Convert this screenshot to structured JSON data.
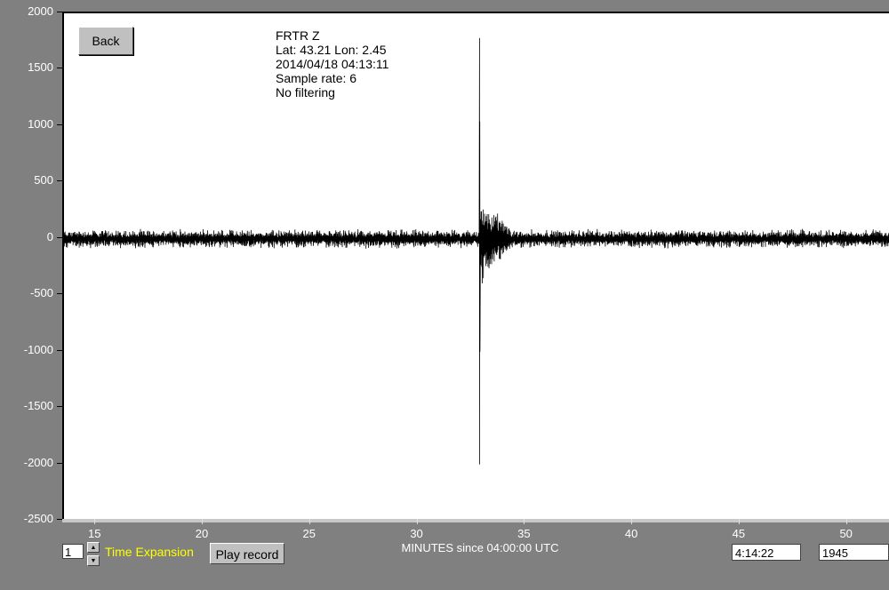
{
  "plot": {
    "info": {
      "station": "FRTR  Z",
      "location": "Lat: 43.21 Lon: 2.45",
      "datetime": "2014/04/18 04:13:11",
      "sample_rate": "Sample rate: 6",
      "filter": "No filtering"
    }
  },
  "controls": {
    "back_label": "Back",
    "time_expansion_value": "1",
    "time_expansion_label": "Time Expansion",
    "play_label": "Play record",
    "cursor_time": "4:14:22",
    "sample_index": "1945"
  },
  "colors": {
    "background": "#808080",
    "plot_bg": "#ffffff",
    "trace": "#000000",
    "axis_text": "#ffffff",
    "time_expansion_label": "#ffff00"
  },
  "chart_data": {
    "type": "line",
    "xlabel": "MINUTES since 04:00:00 UTC",
    "ylabel": "",
    "xlim": [
      13.5,
      52
    ],
    "ylim": [
      -2500,
      2000
    ],
    "xticks": [
      "15",
      "20",
      "25",
      "30",
      "35",
      "40",
      "45",
      "50"
    ],
    "yticks": [
      "2000",
      "1500",
      "1000",
      "500",
      "0",
      "-500",
      "-1000",
      "-1500",
      "-2000",
      "-2500"
    ],
    "series": [
      {
        "values_summary": {
          "baseline_noise_amplitude": 90,
          "event_onset_minute": 32.85,
          "event_peak_positive": 1780,
          "event_peak_negative": -2000,
          "secondary_peak": 1040,
          "coda_amplitude": 450,
          "coda_end_minute": 34.3
        }
      }
    ],
    "grid": false
  }
}
